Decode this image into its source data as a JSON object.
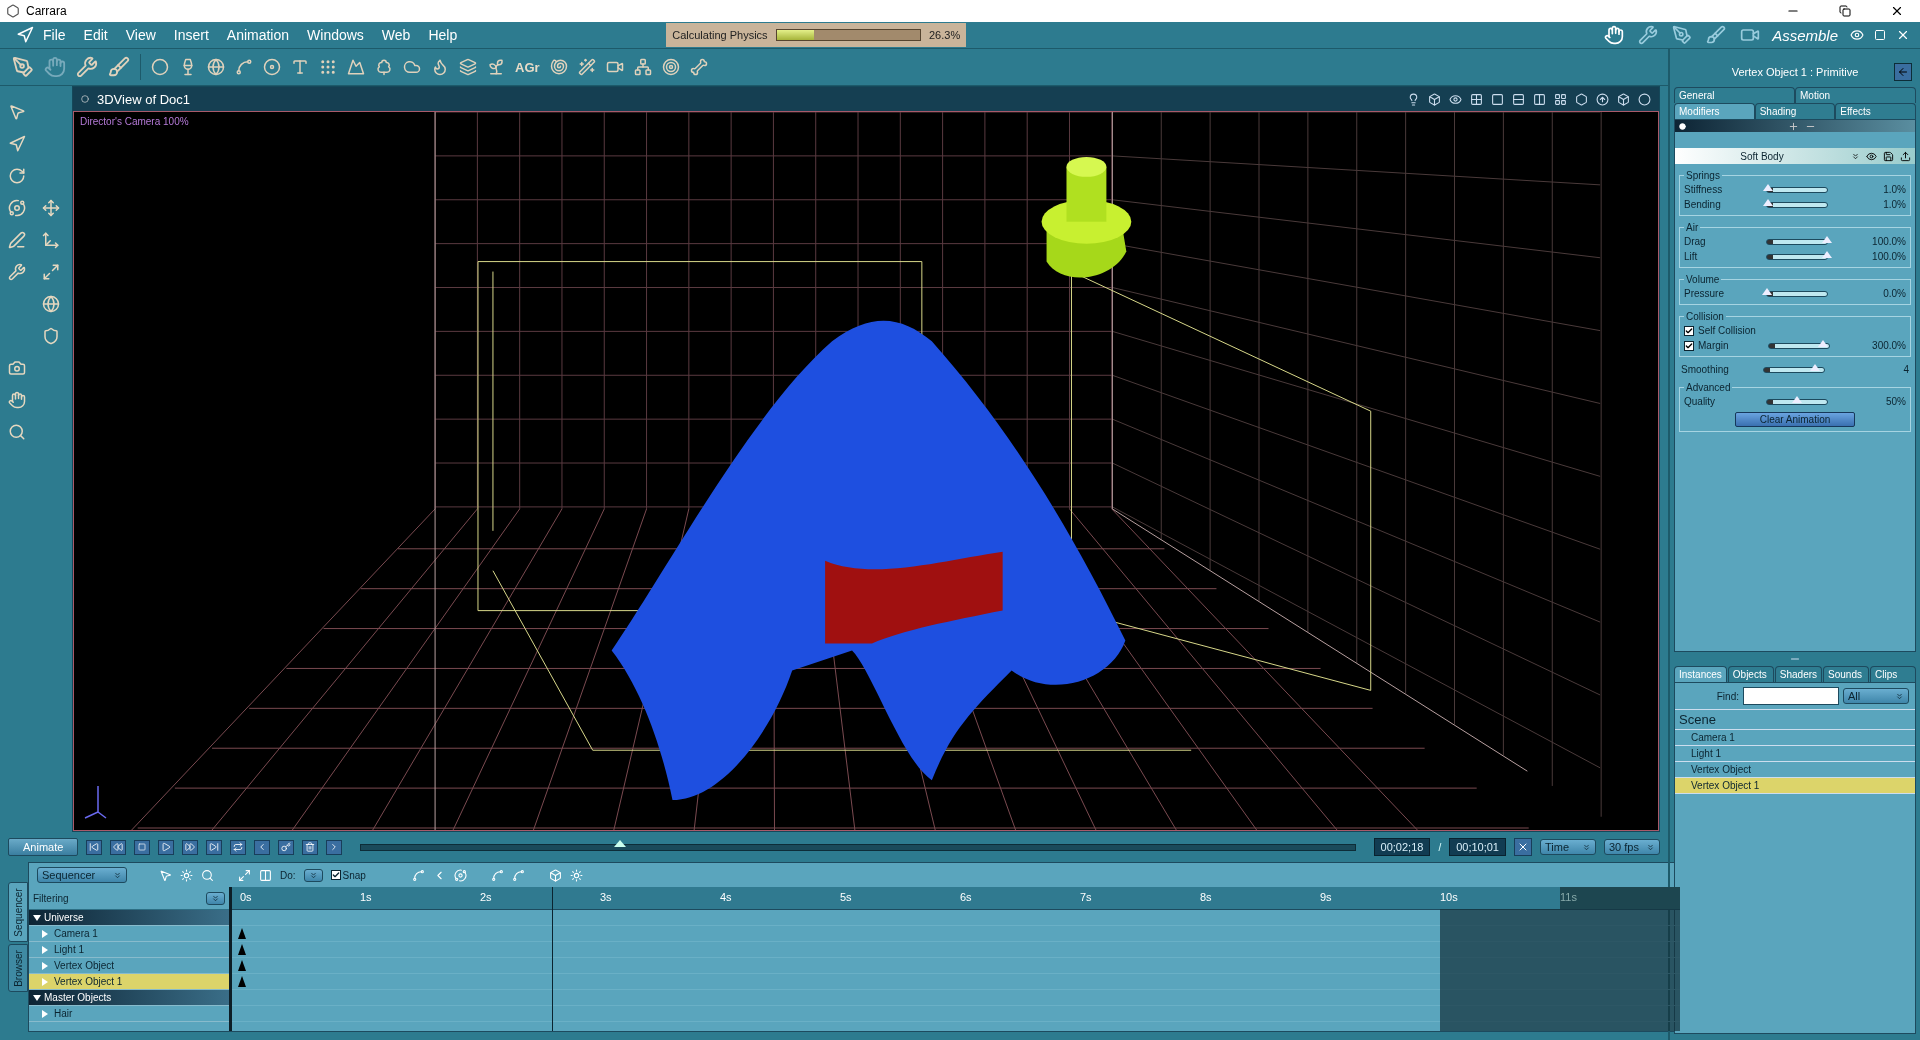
{
  "window": {
    "title": "Carrara"
  },
  "menu": [
    "File",
    "Edit",
    "View",
    "Insert",
    "Animation",
    "Windows",
    "Web",
    "Help"
  ],
  "progress": {
    "label": "Calculating Physics",
    "level": 0.263,
    "reading": "26.3%"
  },
  "room": {
    "label": "Assemble"
  },
  "toolbar": {
    "text_tool_label": "AGr"
  },
  "view": {
    "title": "3DView of Doc1",
    "camera": "Director's Camera 100%"
  },
  "properties": {
    "title": "Vertex Object 1 : Primitive",
    "tabs_top": [
      {
        "label": "General",
        "selected": false
      },
      {
        "label": "Motion",
        "selected": false
      }
    ],
    "tabs_bottom": [
      {
        "label": "Modifiers",
        "selected": true
      },
      {
        "label": "Shading",
        "selected": false
      },
      {
        "label": "Effects",
        "selected": false
      }
    ],
    "modifier": "Soft Body",
    "sections": [
      {
        "kind": "group",
        "title": "Springs",
        "rows": [
          {
            "kind": "slider",
            "label": "Stiffness",
            "level": 0.01,
            "reading": "1.0%"
          },
          {
            "kind": "slider",
            "label": "Bending",
            "level": 0.01,
            "reading": "1.0%"
          }
        ]
      },
      {
        "kind": "group",
        "title": "Air",
        "rows": [
          {
            "kind": "slider",
            "label": "Drag",
            "level": 1,
            "reading": "100.0%"
          },
          {
            "kind": "slider",
            "label": "Lift",
            "level": 1,
            "reading": "100.0%"
          }
        ]
      },
      {
        "kind": "group",
        "title": "Volume",
        "rows": [
          {
            "kind": "slider",
            "label": "Pressure",
            "level": 0,
            "reading": "0.0%"
          }
        ]
      },
      {
        "kind": "group",
        "title": "Collision",
        "rows": [
          {
            "kind": "checkbox",
            "label": "Self Collision",
            "checked": true
          },
          {
            "kind": "checkslider",
            "label": "Margin",
            "checked": true,
            "level": 0.9,
            "reading": "300.0%"
          }
        ]
      },
      {
        "kind": "slider",
        "label": "Smoothing",
        "level": 0.85,
        "reading": "4"
      },
      {
        "kind": "group",
        "title": "Advanced",
        "rows": [
          {
            "kind": "slider",
            "label": "Quality",
            "level": 0.5,
            "reading": "50%"
          },
          {
            "kind": "button",
            "label": "Clear Animation"
          }
        ]
      }
    ]
  },
  "browser": {
    "tabs": [
      {
        "label": "Instances",
        "selected": true
      },
      {
        "label": "Objects",
        "selected": false
      },
      {
        "label": "Shaders",
        "selected": false
      },
      {
        "label": "Sounds",
        "selected": false
      },
      {
        "label": "Clips",
        "selected": false
      }
    ],
    "find_label": "Find:",
    "filter": "All",
    "heading": "Scene",
    "items": [
      {
        "label": "Camera 1",
        "selected": false
      },
      {
        "label": "Light 1",
        "selected": false
      },
      {
        "label": "Vertex Object",
        "selected": false
      },
      {
        "label": "Vertex Object 1",
        "selected": true
      }
    ]
  },
  "transport": {
    "animate": "Animate",
    "level": 0.26,
    "current": "00;02;18",
    "separator": "/",
    "total": "00;10;01",
    "mode": "Time",
    "fps": "30 fps"
  },
  "sequencer": {
    "side_tabs": [
      {
        "label": "Sequencer",
        "selected": true
      },
      {
        "label": "Browser",
        "selected": false
      }
    ],
    "mode": "Sequencer",
    "do_label": "Do:",
    "snap": {
      "label": "Snap",
      "checked": true
    },
    "filter": "Filtering",
    "ticks": [
      "0s",
      "1s",
      "2s",
      "3s",
      "4s",
      "5s",
      "6s",
      "7s",
      "8s",
      "9s",
      "10s",
      "11s"
    ],
    "tree": [
      {
        "label": "Universe",
        "expanded": true,
        "children": [
          {
            "label": "Camera 1",
            "selected": false,
            "keyframe": true
          },
          {
            "label": "Light 1",
            "selected": false,
            "keyframe": true
          },
          {
            "label": "Vertex Object",
            "selected": false,
            "keyframe": true
          },
          {
            "label": "Vertex Object 1",
            "selected": true,
            "keyframe": true
          }
        ]
      },
      {
        "label": "Master Objects",
        "expanded": true,
        "children": [
          {
            "label": "Hair",
            "selected": false,
            "keyframe": false
          }
        ]
      }
    ]
  }
}
